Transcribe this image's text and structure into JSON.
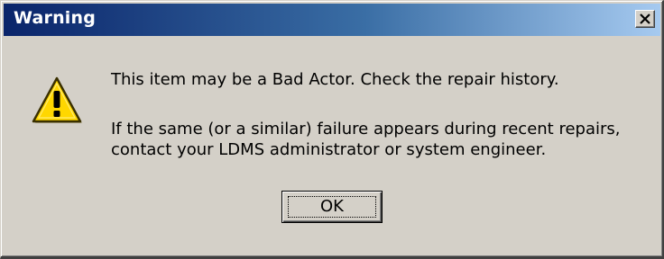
{
  "window": {
    "title": "Warning",
    "close_icon": "close-icon"
  },
  "message": {
    "icon": "warning-icon",
    "line1": "This item may be a Bad Actor.  Check the repair history.",
    "line2": "If the same (or a similar) failure appears during recent repairs,",
    "line3": "contact your LDMS administrator or system engineer."
  },
  "buttons": {
    "ok_label": "OK"
  },
  "colors": {
    "titlebar_start": "#0a246a",
    "titlebar_end": "#a6caf0",
    "dialog_face": "#d4d0c8",
    "warning_fill": "#ffd700"
  }
}
